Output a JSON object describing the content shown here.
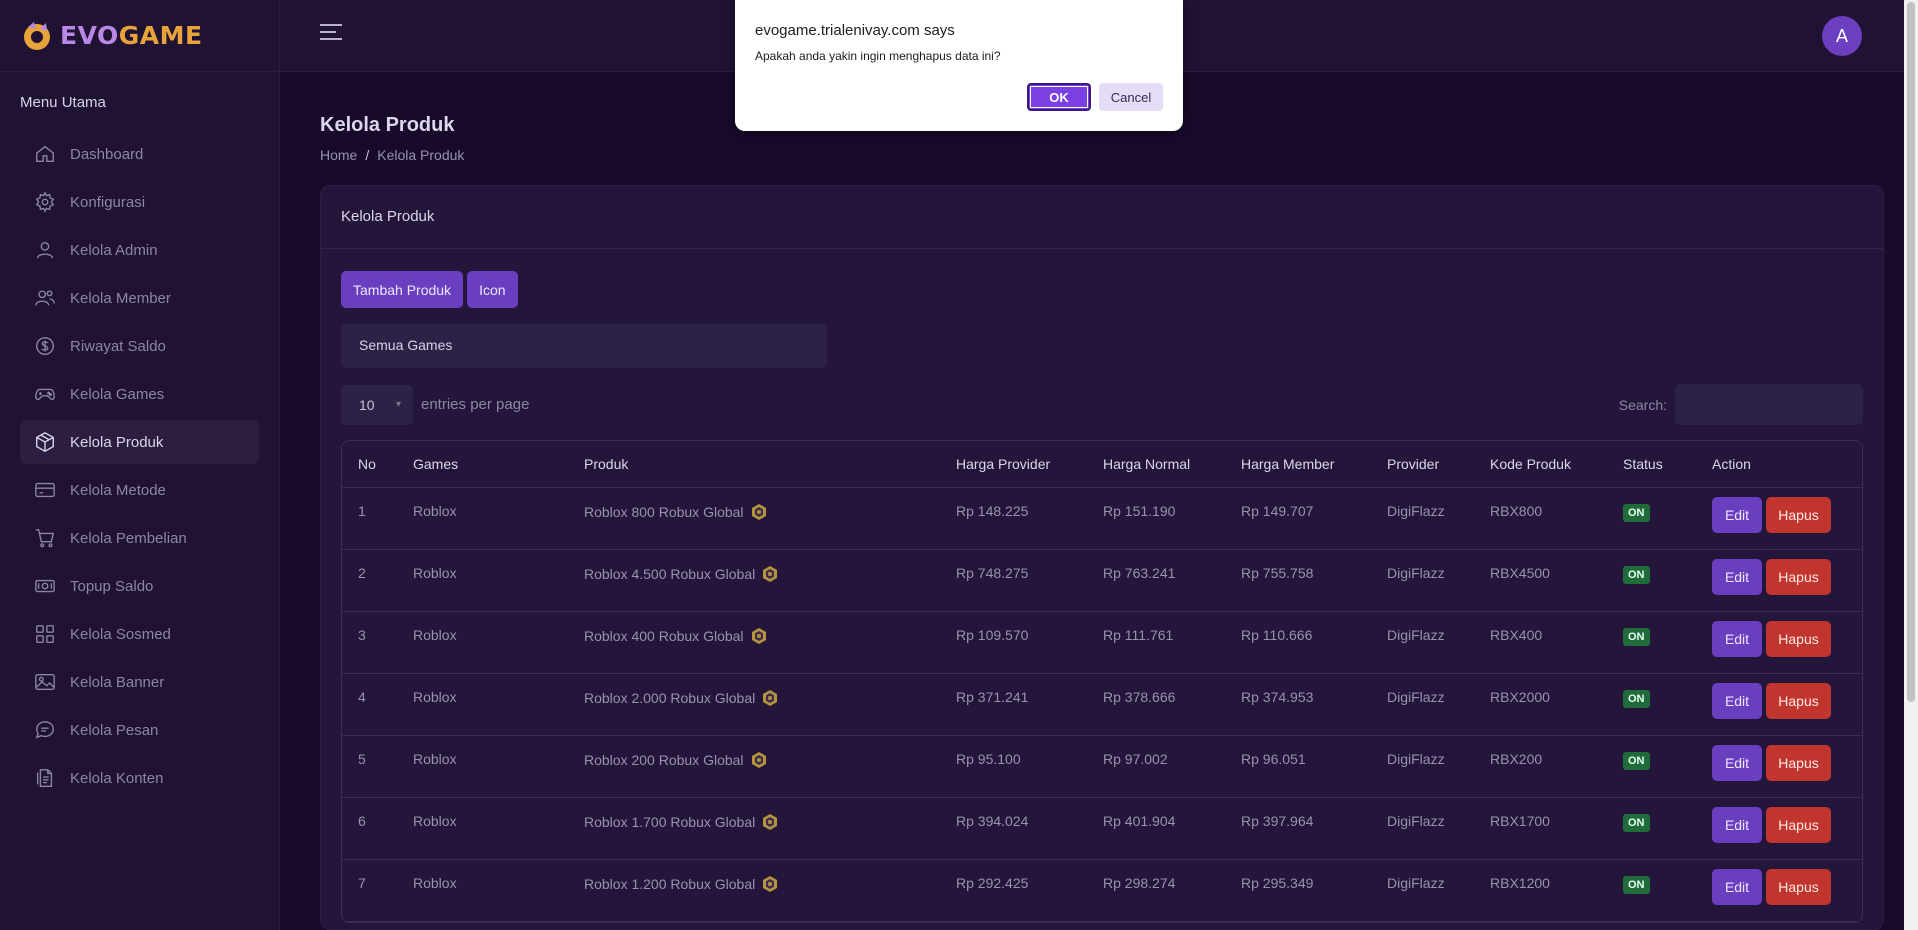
{
  "brand": {
    "part1": "EVO",
    "part2": "GAME"
  },
  "sidebar": {
    "heading": "Menu Utama",
    "items": [
      {
        "label": "Dashboard",
        "icon": "home-icon"
      },
      {
        "label": "Konfigurasi",
        "icon": "gear-icon"
      },
      {
        "label": "Kelola Admin",
        "icon": "user-icon"
      },
      {
        "label": "Kelola Member",
        "icon": "users-icon"
      },
      {
        "label": "Riwayat Saldo",
        "icon": "dollar-circle-icon"
      },
      {
        "label": "Kelola Games",
        "icon": "gamepad-icon"
      },
      {
        "label": "Kelola Produk",
        "icon": "box-icon",
        "active": true
      },
      {
        "label": "Kelola Metode",
        "icon": "card-icon"
      },
      {
        "label": "Kelola Pembelian",
        "icon": "cart-icon"
      },
      {
        "label": "Topup Saldo",
        "icon": "money-icon"
      },
      {
        "label": "Kelola Sosmed",
        "icon": "grid-icon"
      },
      {
        "label": "Kelola Banner",
        "icon": "image-icon"
      },
      {
        "label": "Kelola Pesan",
        "icon": "chat-icon"
      },
      {
        "label": "Kelola Konten",
        "icon": "document-icon"
      }
    ]
  },
  "topbar": {
    "avatar_letter": "A"
  },
  "page": {
    "title": "Kelola Produk",
    "breadcrumb": {
      "home": "Home",
      "sep": "/",
      "current": "Kelola Produk"
    }
  },
  "card": {
    "title": "Kelola Produk",
    "add_button": "Tambah Produk",
    "icon_button": "Icon",
    "games_filter": "Semua Games",
    "entries_value": "10",
    "entries_label": "entries per page",
    "search_label": "Search:"
  },
  "table": {
    "headers": [
      "No",
      "Games",
      "Produk",
      "Harga Provider",
      "Harga Normal",
      "Harga Member",
      "Provider",
      "Kode Produk",
      "Status",
      "Action"
    ],
    "rows": [
      {
        "no": "1",
        "game": "Roblox",
        "produk": "Roblox 800 Robux Global",
        "provider_price": "Rp 148.225",
        "normal": "Rp 151.190",
        "member": "Rp 149.707",
        "provider": "DigiFlazz",
        "kode": "RBX800",
        "status": "ON"
      },
      {
        "no": "2",
        "game": "Roblox",
        "produk": "Roblox 4.500 Robux Global",
        "provider_price": "Rp 748.275",
        "normal": "Rp 763.241",
        "member": "Rp 755.758",
        "provider": "DigiFlazz",
        "kode": "RBX4500",
        "status": "ON"
      },
      {
        "no": "3",
        "game": "Roblox",
        "produk": "Roblox 400 Robux Global",
        "provider_price": "Rp 109.570",
        "normal": "Rp 111.761",
        "member": "Rp 110.666",
        "provider": "DigiFlazz",
        "kode": "RBX400",
        "status": "ON"
      },
      {
        "no": "4",
        "game": "Roblox",
        "produk": "Roblox 2.000 Robux Global",
        "provider_price": "Rp 371.241",
        "normal": "Rp 378.666",
        "member": "Rp 374.953",
        "provider": "DigiFlazz",
        "kode": "RBX2000",
        "status": "ON"
      },
      {
        "no": "5",
        "game": "Roblox",
        "produk": "Roblox 200 Robux Global",
        "provider_price": "Rp 95.100",
        "normal": "Rp 97.002",
        "member": "Rp 96.051",
        "provider": "DigiFlazz",
        "kode": "RBX200",
        "status": "ON"
      },
      {
        "no": "6",
        "game": "Roblox",
        "produk": "Roblox 1.700 Robux Global",
        "provider_price": "Rp 394.024",
        "normal": "Rp 401.904",
        "member": "Rp 397.964",
        "provider": "DigiFlazz",
        "kode": "RBX1700",
        "status": "ON"
      },
      {
        "no": "7",
        "game": "Roblox",
        "produk": "Roblox 1.200 Robux Global",
        "provider_price": "Rp 292.425",
        "normal": "Rp 298.274",
        "member": "Rp 295.349",
        "provider": "DigiFlazz",
        "kode": "RBX1200",
        "status": "ON"
      }
    ],
    "edit_label": "Edit",
    "delete_label": "Hapus"
  },
  "dialog": {
    "title": "evogame.trialenivay.com says",
    "message": "Apakah anda yakin ingin menghapus data ini?",
    "ok_label": "OK",
    "cancel_label": "Cancel"
  },
  "colors": {
    "accent": "#6a3fbf",
    "danger": "#c0352e",
    "status_on": "#1f6b3a",
    "background": "#170a2a"
  }
}
